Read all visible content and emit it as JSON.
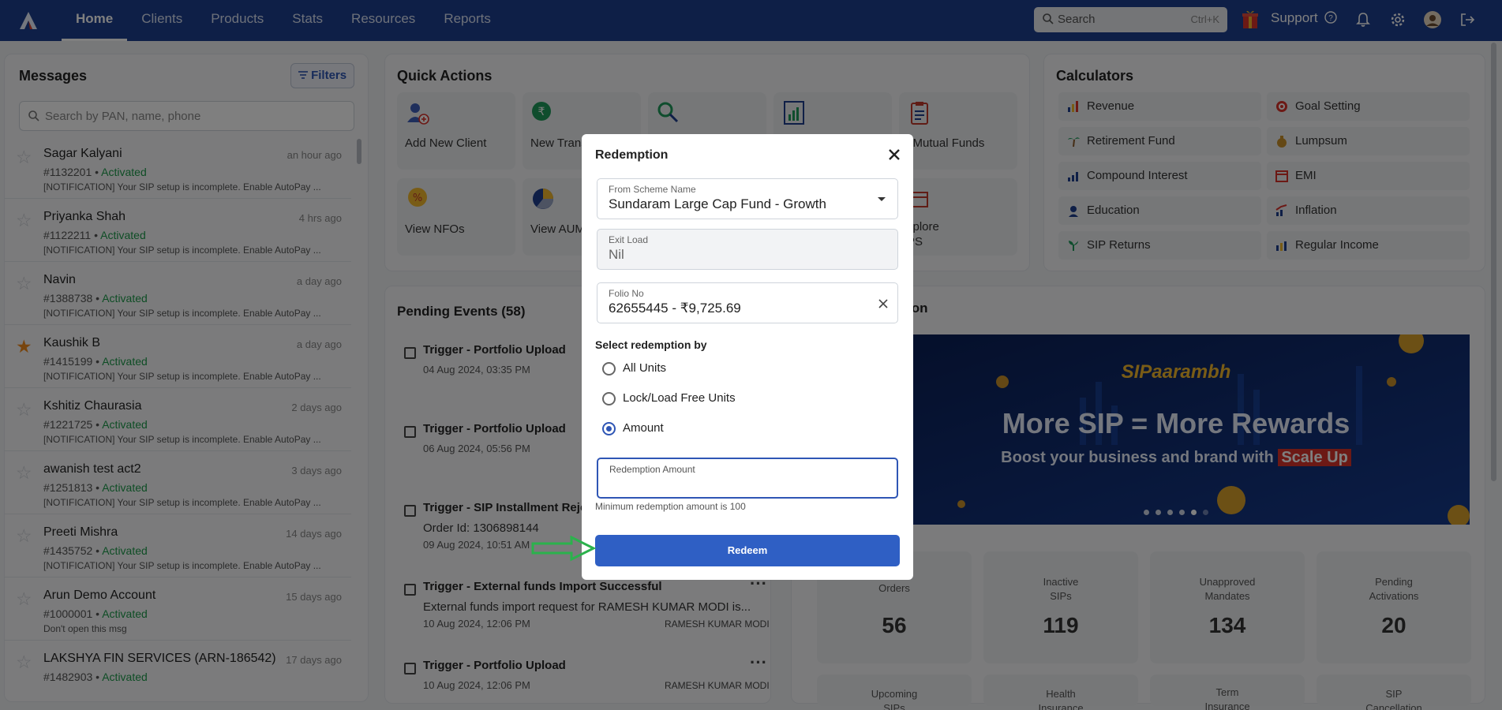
{
  "nav": {
    "items": [
      "Home",
      "Clients",
      "Products",
      "Stats",
      "Resources",
      "Reports"
    ]
  },
  "topbar": {
    "search_placeholder": "Search",
    "search_shortcut": "Ctrl+K",
    "support_label": "Support"
  },
  "messages": {
    "title": "Messages",
    "filters_label": "Filters",
    "search_placeholder": "Search by PAN, name, phone",
    "items": [
      {
        "name": "Sagar Kalyani",
        "time": "an hour ago",
        "id": "#1132201",
        "status": "Activated",
        "text": "[NOTIFICATION] Your SIP setup is incomplete. Enable AutoPay ...",
        "starred": false
      },
      {
        "name": "Priyanka Shah",
        "time": "4 hrs ago",
        "id": "#1122211",
        "status": "Activated",
        "text": "[NOTIFICATION] Your SIP setup is incomplete. Enable AutoPay ...",
        "starred": false
      },
      {
        "name": "Navin",
        "time": "a day ago",
        "id": "#1388738",
        "status": "Activated",
        "text": "[NOTIFICATION] Your SIP setup is incomplete. Enable AutoPay ...",
        "starred": false
      },
      {
        "name": "Kaushik B",
        "time": "a day ago",
        "id": "#1415199",
        "status": "Activated",
        "text": "[NOTIFICATION] Your SIP setup is incomplete. Enable AutoPay ...",
        "starred": true
      },
      {
        "name": "Kshitiz Chaurasia",
        "time": "2 days ago",
        "id": "#1221725",
        "status": "Activated",
        "text": "[NOTIFICATION] Your SIP setup is incomplete. Enable AutoPay ...",
        "starred": false
      },
      {
        "name": "awanish test act2",
        "time": "3 days ago",
        "id": "#1251813",
        "status": "Activated",
        "text": "[NOTIFICATION] Your SIP setup is incomplete. Enable AutoPay ...",
        "starred": false
      },
      {
        "name": "Preeti Mishra",
        "time": "14 days ago",
        "id": "#1435752",
        "status": "Activated",
        "text": "[NOTIFICATION] Your SIP setup is incomplete. Enable AutoPay ...",
        "starred": false
      },
      {
        "name": "Arun Demo Account",
        "time": "15 days ago",
        "id": "#1000001",
        "status": "Activated",
        "text": "Don't open this msg",
        "starred": false
      },
      {
        "name": "LAKSHYA FIN SERVICES (ARN-186542)",
        "time": "17 days ago",
        "id": "#1482903",
        "status": "Activated",
        "text": "",
        "starred": false
      }
    ]
  },
  "quick_actions": {
    "title": "Quick Actions",
    "tiles": [
      {
        "label": "Add New Client",
        "icon": "add-client-icon"
      },
      {
        "label": "New Trans",
        "icon": "rupee-transaction-icon"
      },
      {
        "label": "",
        "icon": "search-money-icon"
      },
      {
        "label": "",
        "icon": "chart-report-icon"
      },
      {
        "label": "l Mutual Funds",
        "icon": "clipboard-icon"
      },
      {
        "label": "View NFOs",
        "icon": "nfo-badge-icon"
      },
      {
        "label": "View AUM",
        "icon": "pie-chart-icon"
      },
      {
        "label": "",
        "icon": "blank-icon"
      },
      {
        "label": "",
        "icon": "blank-icon"
      },
      {
        "label": "xplore\nPS",
        "icon": "nps-icon"
      }
    ]
  },
  "calculators": {
    "title": "Calculators",
    "items": [
      "Revenue",
      "Goal Setting",
      "Retirement Fund",
      "Lumpsum",
      "Compound Interest",
      "EMI",
      "Education",
      "Inflation",
      "SIP Returns",
      "Regular Income"
    ]
  },
  "pending_events": {
    "title": "Pending Events (58)",
    "items": [
      {
        "title": "Trigger - Portfolio Upload",
        "line": "",
        "date": "04 Aug 2024, 03:35 PM",
        "client": ""
      },
      {
        "title": "Trigger - Portfolio Upload",
        "line": "",
        "date": "06 Aug 2024, 05:56 PM",
        "client": ""
      },
      {
        "title": "Trigger - SIP Installment Rejec",
        "line": "Order Id: 1306898144",
        "date": "09 Aug 2024, 10:51 AM",
        "client": ""
      },
      {
        "title": "Trigger - External funds Import Successful",
        "line": "External funds import request for RAMESH KUMAR MODI is...",
        "date": "10 Aug 2024, 12:06 PM",
        "client": "RAMESH KUMAR MODI"
      },
      {
        "title": "Trigger - Portfolio Upload",
        "line": "",
        "date": "10 Aug 2024, 12:06 PM",
        "client": "RAMESH KUMAR MODI"
      }
    ]
  },
  "promo": {
    "section_title_fragment": "ion",
    "brand": "SIPaarambh",
    "headline": "More SIP = More Rewards",
    "subline_prefix": "Boost your business and brand with",
    "subline_highlight": "Scale Up",
    "active_slide_index": 4,
    "slide_count": 6
  },
  "stats": {
    "row1": [
      {
        "label": "Orders",
        "value": "56"
      },
      {
        "label": "Inactive\nSIPs",
        "value": "119"
      },
      {
        "label": "Unapproved\nMandates",
        "value": "134"
      },
      {
        "label": "Pending\nActivations",
        "value": "20"
      }
    ],
    "row2": [
      {
        "label": "Upcoming\nSIPs"
      },
      {
        "label": "Health\nInsurance"
      },
      {
        "label": "Term\nInsurance"
      },
      {
        "label": "SIP\nCancellation"
      }
    ]
  },
  "modal": {
    "title": "Redemption",
    "scheme_label": "From Scheme Name",
    "scheme_value": "Sundaram Large Cap Fund - Growth",
    "exit_load_label": "Exit Load",
    "exit_load_value": "Nil",
    "folio_label": "Folio No",
    "folio_value": "62655445 - ₹9,725.69",
    "redemption_by_label": "Select redemption by",
    "options": [
      "All Units",
      "Lock/Load Free Units",
      "Amount"
    ],
    "selected_option": "Amount",
    "amount_label": "Redemption Amount",
    "amount_value": "",
    "hint": "Minimum redemption amount is 100",
    "submit_label": "Redeem"
  },
  "colors": {
    "topbar": "#1d3f8f",
    "accent": "#2f5fc4",
    "activated": "#1d9a4a",
    "star": "#f08a1c",
    "annotation_arrow": "#2bb24c"
  }
}
